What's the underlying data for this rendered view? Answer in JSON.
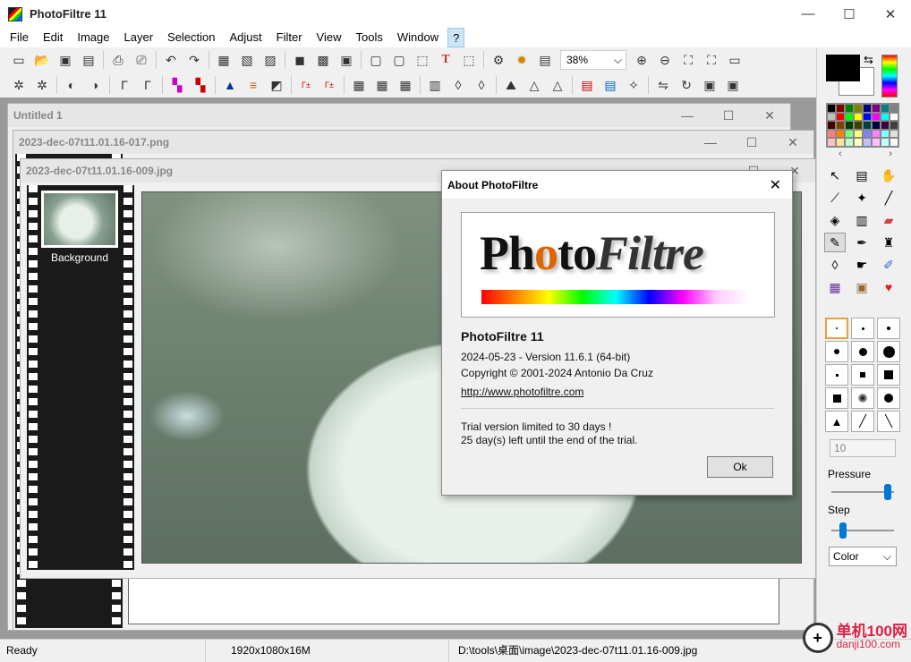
{
  "app": {
    "title": "PhotoFiltre 11"
  },
  "window_controls": {
    "minimize": "—",
    "maximize": "☐",
    "close": "✕"
  },
  "menu": [
    "File",
    "Edit",
    "Image",
    "Layer",
    "Selection",
    "Adjust",
    "Filter",
    "View",
    "Tools",
    "Window",
    "?"
  ],
  "toolbar": {
    "zoom_value": "38%",
    "zoom_arrow": "⌵"
  },
  "toolbar1_icons": [
    "new-icon",
    "open-icon",
    "save-icon",
    "save-as-icon",
    "print-icon",
    "scan-icon",
    "undo-icon",
    "redo-icon",
    "image-size-icon",
    "canvas-size-icon",
    "crop-icon",
    "layer-icon",
    "palette-icon",
    "grayscale-icon",
    "text-icon",
    "select-icon",
    "transform-icon",
    "frame-icon",
    "plugin-icon",
    "browser-icon",
    "zoom-in-icon",
    "zoom-out-icon",
    "fit-icon",
    "actual-size-icon",
    "slideshow-icon"
  ],
  "toolbar2_icons": [
    "sparkle-icon",
    "sparkle-plus-icon",
    "brightness-down-icon",
    "brightness-up-icon",
    "contrast-down-icon",
    "contrast-up-icon",
    "color-down-icon",
    "color-up-icon",
    "levels-icon",
    "curves-icon",
    "gradient-icon",
    "auto-levels-icon",
    "auto-contrast-icon",
    "mosaic-icon",
    "mosaic2-icon",
    "texture-icon",
    "book-icon",
    "drop-icon",
    "drop2-icon",
    "mountain-icon",
    "triangle-icon",
    "triangle2-icon",
    "gradient-map-icon",
    "shadow-icon",
    "blur-icon",
    "flip-h-icon",
    "rotate-icon",
    "border-icon"
  ],
  "documents": [
    {
      "title": "Untitled 1"
    },
    {
      "title": "2023-dec-07t11.01.16-017.png"
    },
    {
      "title": "2023-dec-07t11.01.16-009.jpg"
    }
  ],
  "layers_panel": {
    "layer_label": "Background"
  },
  "about_dialog": {
    "title": "About PhotoFiltre",
    "close": "✕",
    "logo_part1": "Ph",
    "logo_part2": "o",
    "logo_part3": "to",
    "logo_part4": "Filtre",
    "product": "PhotoFiltre 11",
    "version": "2024-05-23 - Version 11.6.1 (64-bit)",
    "copyright": "Copyright © 2001-2024  Antonio Da Cruz",
    "url": "http://www.photofiltre.com",
    "trial_line1": "Trial version limited to 30 days !",
    "trial_line2": "25 day(s) left until the end of the trial.",
    "ok_label": "Ok"
  },
  "right_panel": {
    "palette_colors": [
      "#000000",
      "#800000",
      "#008000",
      "#808000",
      "#000080",
      "#800080",
      "#008080",
      "#808080",
      "#c0c0c0",
      "#ff0000",
      "#00ff00",
      "#ffff00",
      "#0000ff",
      "#ff00ff",
      "#00ffff",
      "#ffffff",
      "#400000",
      "#804000",
      "#004000",
      "#404000",
      "#004040",
      "#000040",
      "#400040",
      "#404040",
      "#ff8080",
      "#ff8000",
      "#80ff80",
      "#ffff80",
      "#8080ff",
      "#ff80ff",
      "#80ffff",
      "#e0e0e0",
      "#ffc0c0",
      "#ffe0a0",
      "#c0ffc0",
      "#ffffc0",
      "#c0c0ff",
      "#ffc0ff",
      "#c0ffff",
      "#f8f8f8"
    ],
    "palette_prev": "‹",
    "palette_next": "›",
    "size_value": "10",
    "pressure_label": "Pressure",
    "pressure_level": 0.95,
    "step_label": "Step",
    "step_level": 0.15,
    "mode_select": "Color"
  },
  "status": {
    "state": "Ready",
    "dimensions": "1920x1080x16M",
    "path": "D:\\tools\\桌面\\image\\2023-dec-07t11.01.16-009.jpg"
  },
  "watermark": {
    "name": "单机100网",
    "domain": "danji100.com"
  }
}
